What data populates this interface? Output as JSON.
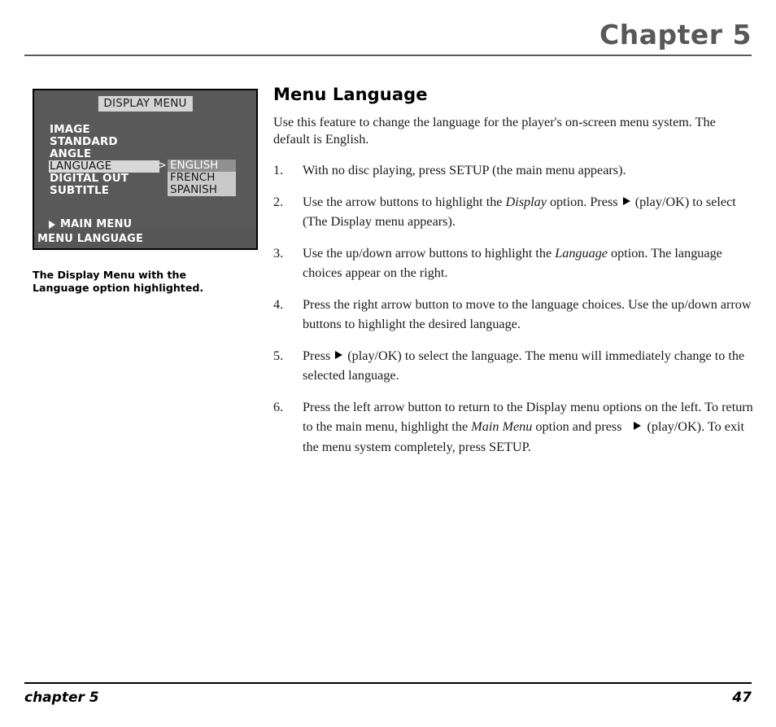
{
  "header": {
    "chapter_title": "Chapter 5"
  },
  "osd": {
    "menu_title": "DISPLAY MENU",
    "items": [
      {
        "label": "IMAGE",
        "selected": false
      },
      {
        "label": "STANDARD",
        "selected": false
      },
      {
        "label": "ANGLE",
        "selected": false
      },
      {
        "label": "LANGUAGE",
        "selected": true
      },
      {
        "label": "DIGITAL OUT",
        "selected": false
      },
      {
        "label": "SUBTITLE",
        "selected": false
      }
    ],
    "chevrons": ">>",
    "choices": [
      {
        "label": "ENGLISH",
        "active": true
      },
      {
        "label": "FRENCH",
        "active": false
      },
      {
        "label": "SPANISH",
        "active": false
      }
    ],
    "main_menu_label": "MAIN MENU",
    "status_label": "MENU LANGUAGE",
    "colors": {
      "menu_background": "#595959",
      "status_background": "#565656",
      "title_background": "#d4d4d4",
      "selected_row_background": "#d8d8d8",
      "choices_background": "#c9c9c9",
      "active_choice_background": "#919191"
    }
  },
  "caption": {
    "line1": "The Display Menu with the Language",
    "line2": "option highlighted."
  },
  "article": {
    "heading": "Menu Language",
    "intro": "Use this feature to change the language for the player's on-screen menu system. The default is English.",
    "steps": [
      {
        "num": "1.",
        "part1": "With no disc playing, press SETUP (the main menu appears).",
        "italic": "",
        "part2": "",
        "part3": ""
      },
      {
        "num": "2.",
        "part1": "Use the arrow buttons to highlight the ",
        "italic": "Display",
        "part2": " option. Press ",
        "part3": " (play/OK) to select (The Display menu appears)."
      },
      {
        "num": "3.",
        "part1": "Use the up/down arrow buttons to highlight the ",
        "italic": "Language",
        "part2": " option.  The language choices appear on the right.",
        "part3": ""
      },
      {
        "num": "4.",
        "part1": "Press the right arrow button to move to the language choices. Use the up/down arrow buttons to highlight the desired language.",
        "italic": "",
        "part2": "",
        "part3": ""
      },
      {
        "num": "5.",
        "part1": "Press ",
        "italic": "",
        "part2": "",
        "part3": " (play/OK) to select the language. The menu will immediately change to the selected language."
      },
      {
        "num": "6.",
        "part1": "Press the left arrow button to return to the Display menu options on the left. To return to the main menu, highlight the ",
        "italic": "Main Menu",
        "part2": " option and press",
        "part3": " (play/OK). To exit the menu system completely, press SETUP."
      }
    ]
  },
  "footer": {
    "left": "chapter 5",
    "page_number": "47"
  }
}
